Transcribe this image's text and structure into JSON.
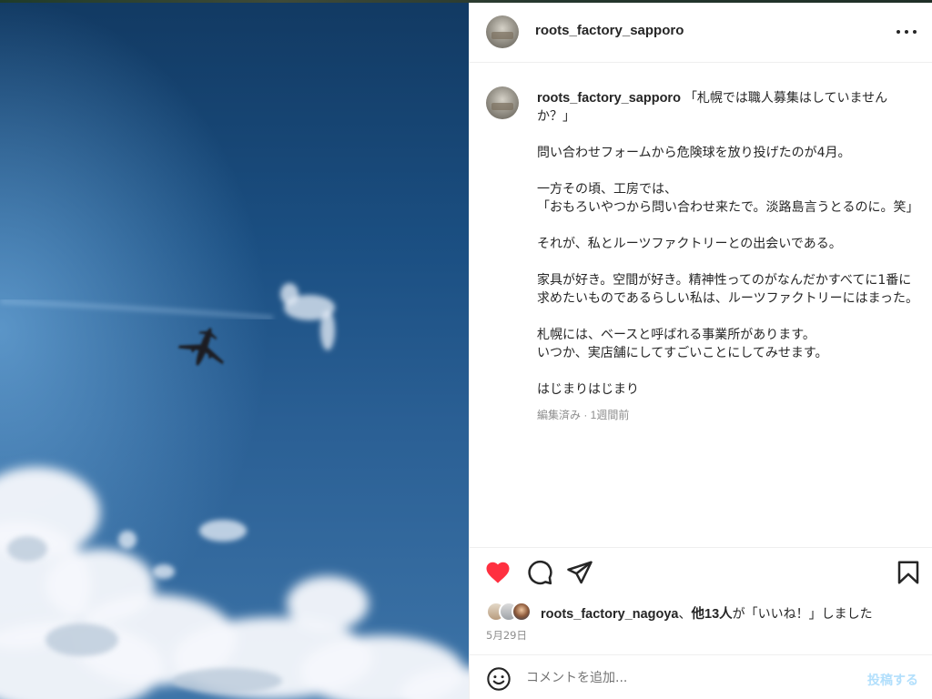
{
  "post": {
    "username": "roots_factory_sapporo",
    "caption_user": "roots_factory_sapporo",
    "caption_paragraphs": [
      "「札幌では職人募集はしていませんか？」",
      "問い合わせフォームから危険球を放り投げたのが4月。",
      "一方その頃、工房では、\n「おもろいやつから問い合わせ来たで。淡路島言うとるのに。笑」",
      "それが、私とルーツファクトリーとの出会いである。",
      "家具が好き。空間が好き。精神性ってのがなんだかすべてに1番に求めたいものであるらしい私は、ルーツファクトリーにはまった。",
      "札幌には、ベースと呼ばれる事業所があります。\nいつか、実店舗にしてすごいことにしてみせます。",
      "はじまりはじまり"
    ],
    "edited_label": "編集済み · 1週間前",
    "liked_by_user": "roots_factory_nagoya",
    "likes_sep": "、",
    "likes_others": "他13人",
    "likes_suffix": "が「いいね！」しました",
    "date": "5月29日",
    "liked": true
  },
  "icons": {
    "more": "more-horizontal-icon",
    "heart": "heart-filled-icon",
    "comment": "comment-icon",
    "share": "share-icon",
    "save": "bookmark-icon",
    "emoji": "emoji-icon"
  },
  "comment_box": {
    "placeholder": "コメントを追加...",
    "post_label": "投稿する"
  },
  "colors": {
    "heart": "#ff3040",
    "text": "#262626",
    "muted": "#8e8e8e",
    "post_button_disabled": "#b2dffc"
  }
}
